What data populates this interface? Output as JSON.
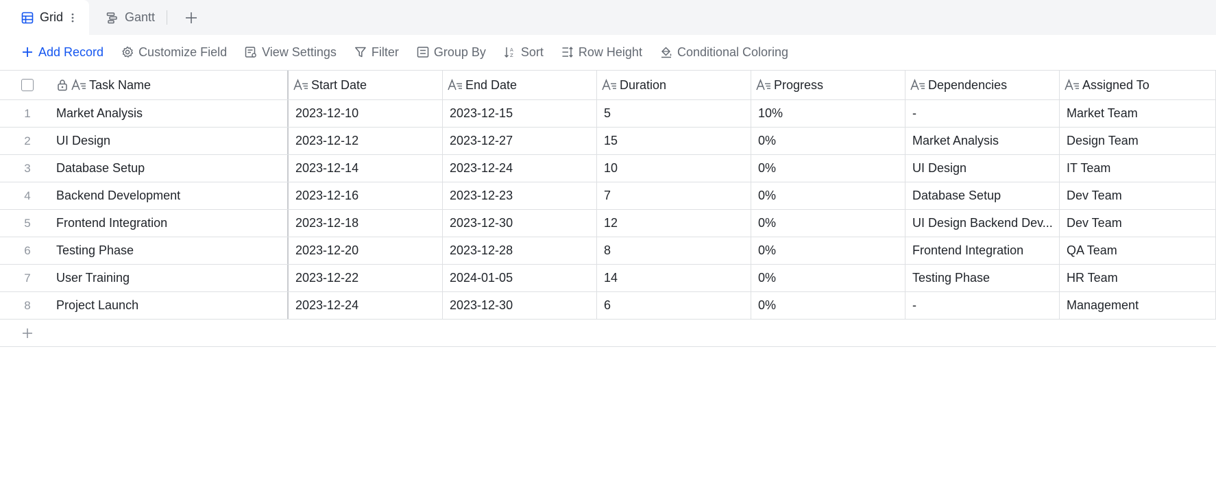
{
  "tabs": [
    {
      "label": "Grid",
      "icon": "grid-icon",
      "active": true
    },
    {
      "label": "Gantt",
      "icon": "gantt-icon",
      "active": false
    }
  ],
  "toolbar": {
    "add_record": "Add Record",
    "customize_field": "Customize Field",
    "view_settings": "View Settings",
    "filter": "Filter",
    "group_by": "Group By",
    "sort": "Sort",
    "row_height": "Row Height",
    "conditional_coloring": "Conditional Coloring"
  },
  "columns": {
    "task": "Task Name",
    "start": "Start Date",
    "end": "End Date",
    "duration": "Duration",
    "progress": "Progress",
    "dependencies": "Dependencies",
    "assigned": "Assigned To"
  },
  "rows": [
    {
      "idx": "1",
      "task": "Market Analysis",
      "start": "2023-12-10",
      "end": "2023-12-15",
      "duration": "5",
      "progress": "10%",
      "dependencies": "-",
      "assigned": "Market Team"
    },
    {
      "idx": "2",
      "task": "UI Design",
      "start": "2023-12-12",
      "end": "2023-12-27",
      "duration": "15",
      "progress": "0%",
      "dependencies": "Market Analysis",
      "assigned": "Design Team"
    },
    {
      "idx": "3",
      "task": "Database Setup",
      "start": "2023-12-14",
      "end": "2023-12-24",
      "duration": "10",
      "progress": "0%",
      "dependencies": "UI Design",
      "assigned": "IT Team"
    },
    {
      "idx": "4",
      "task": "Backend Development",
      "start": "2023-12-16",
      "end": "2023-12-23",
      "duration": "7",
      "progress": "0%",
      "dependencies": "Database Setup",
      "assigned": "Dev Team"
    },
    {
      "idx": "5",
      "task": "Frontend Integration",
      "start": "2023-12-18",
      "end": "2023-12-30",
      "duration": "12",
      "progress": "0%",
      "dependencies": "UI Design Backend Dev...",
      "assigned": "Dev Team"
    },
    {
      "idx": "6",
      "task": "Testing Phase",
      "start": "2023-12-20",
      "end": "2023-12-28",
      "duration": "8",
      "progress": "0%",
      "dependencies": "Frontend Integration",
      "assigned": "QA Team"
    },
    {
      "idx": "7",
      "task": "User Training",
      "start": "2023-12-22",
      "end": "2024-01-05",
      "duration": "14",
      "progress": "0%",
      "dependencies": "Testing Phase",
      "assigned": "HR Team"
    },
    {
      "idx": "8",
      "task": "Project Launch",
      "start": "2023-12-24",
      "end": "2023-12-30",
      "duration": "6",
      "progress": "0%",
      "dependencies": "-",
      "assigned": "Management"
    }
  ],
  "colors": {
    "accent": "#1456f0",
    "muted_text": "#646a73",
    "border": "#dee0e3",
    "tabbar_bg": "#f4f5f7"
  }
}
